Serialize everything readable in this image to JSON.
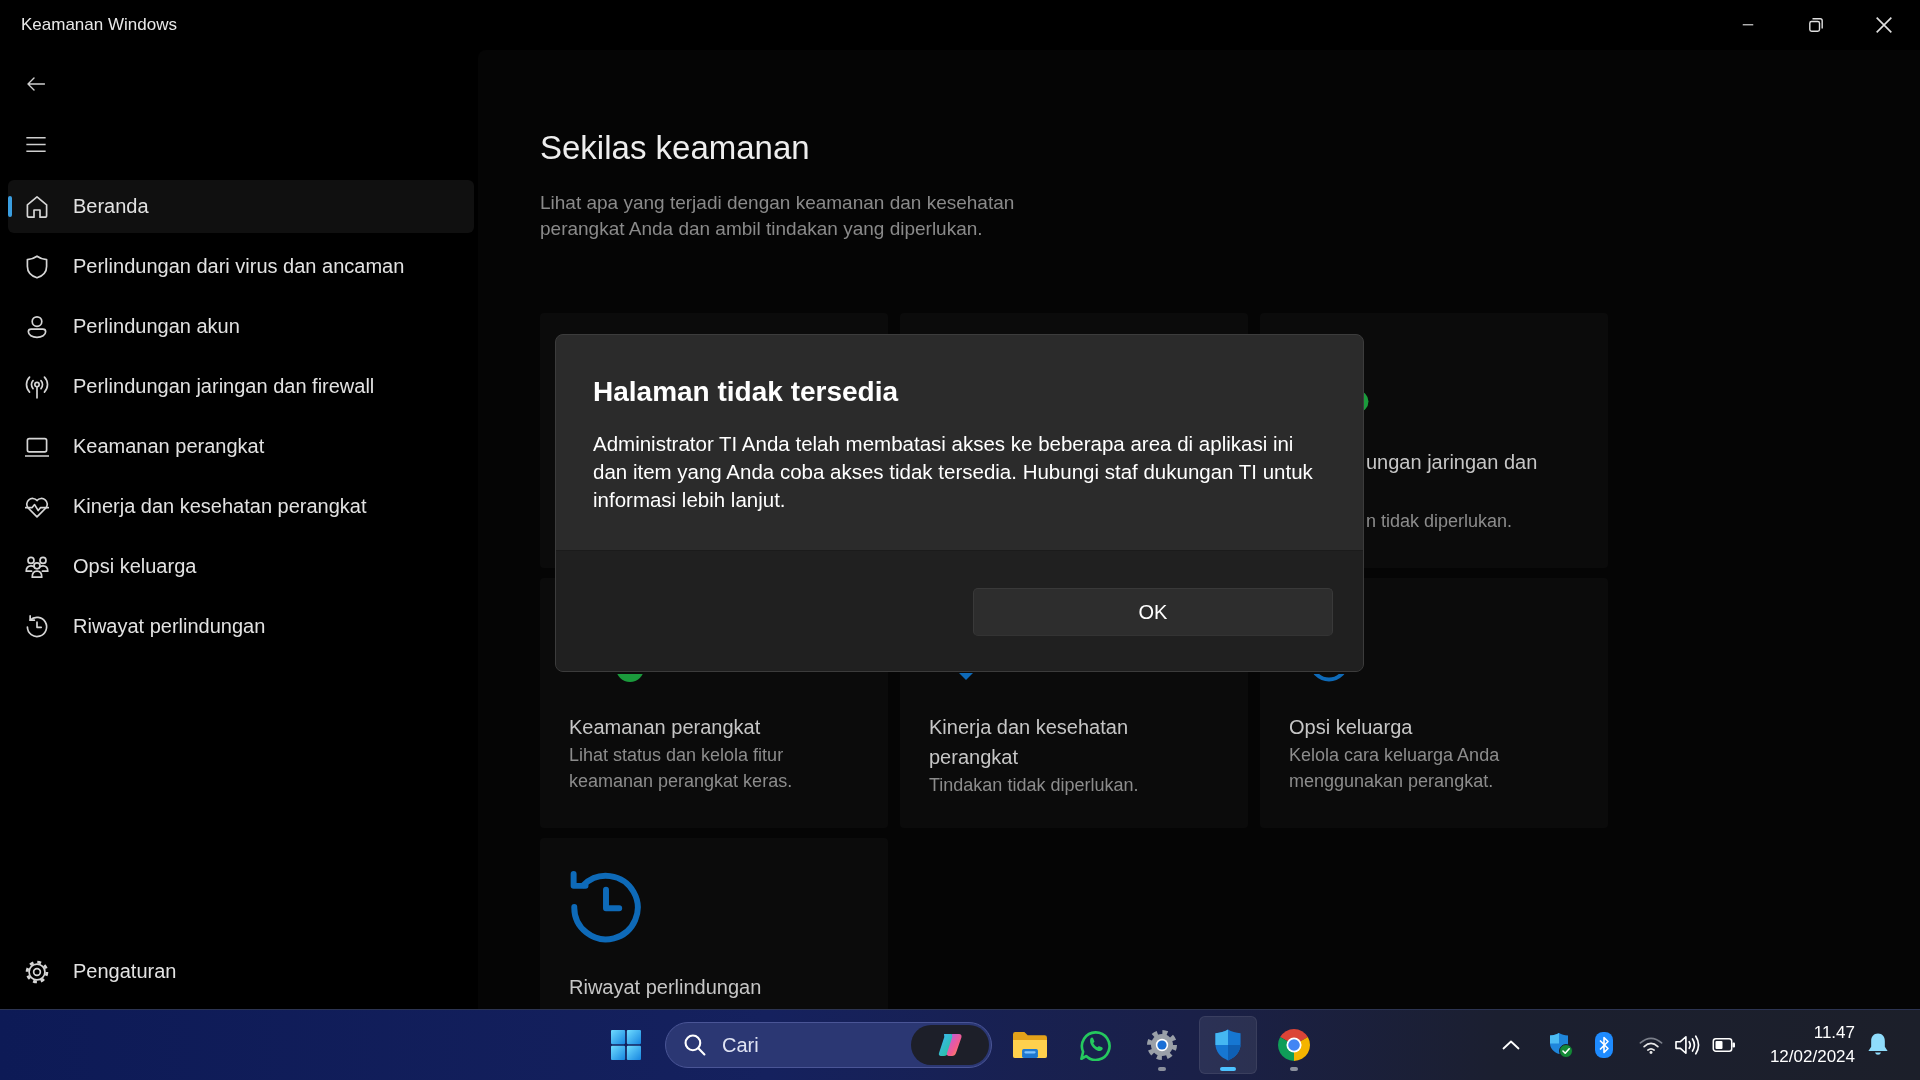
{
  "window": {
    "title": "Keamanan Windows"
  },
  "sidebar": {
    "items": [
      {
        "label": "Beranda",
        "kind": "home",
        "selected": true
      },
      {
        "label": "Perlindungan dari virus dan ancaman",
        "kind": "shield",
        "selected": false
      },
      {
        "label": "Perlindungan akun",
        "kind": "person",
        "selected": false
      },
      {
        "label": "Perlindungan jaringan dan firewall",
        "kind": "antenna",
        "selected": false
      },
      {
        "label": "Keamanan perangkat",
        "kind": "laptop",
        "selected": false
      },
      {
        "label": "Kinerja dan kesehatan perangkat",
        "kind": "heart",
        "selected": false
      },
      {
        "label": "Opsi keluarga",
        "kind": "family",
        "selected": false
      },
      {
        "label": "Riwayat perlindungan",
        "kind": "history",
        "selected": false
      }
    ],
    "settings": {
      "label": "Pengaturan"
    }
  },
  "page": {
    "title": "Sekilas keamanan",
    "subtitle": "Lihat apa yang terjadi dengan keamanan dan kesehatan perangkat Anda dan ambil tindakan yang diperlukan."
  },
  "cards": [
    {
      "kind": "covered"
    },
    {
      "kind": "covered"
    },
    {
      "kind": "side",
      "color": "#1b9a3c",
      "title": "ungan jaringan dan",
      "description": "n tidak diperlukan."
    },
    {
      "kind": "bottom-arc",
      "color": "#1b9a3c",
      "title": "Keamanan perangkat",
      "description": "Lihat status dan kelola fitur keamanan perangkat keras."
    },
    {
      "kind": "bottom-tip",
      "color": "#0e6ab8",
      "title": "Kinerja dan kesehatan perangkat",
      "description": "Tindakan tidak diperlukan."
    },
    {
      "kind": "bottom-ring",
      "color": "#0e6ab8",
      "title": "Opsi keluarga",
      "description": "Kelola cara keluarga Anda menggunakan perangkat."
    },
    {
      "kind": "full",
      "color": "#0e6ab8",
      "title": "Riwayat perlindungan"
    }
  ],
  "dialog": {
    "title": "Halaman tidak tersedia",
    "message": "Administrator TI Anda telah membatasi akses ke beberapa area di aplikasi ini dan item yang Anda coba akses tidak tersedia. Hubungi staf dukungan TI untuk informasi lebih lanjut.",
    "button": "OK"
  },
  "taskbar": {
    "search": {
      "placeholder": "Cari"
    },
    "apps": [
      {
        "kind": "folder",
        "running": false,
        "active": false
      },
      {
        "kind": "chat",
        "running": false,
        "active": false
      },
      {
        "kind": "gear",
        "running": true,
        "active": false
      },
      {
        "kind": "shield",
        "running": true,
        "active": true
      },
      {
        "kind": "browser",
        "running": true,
        "active": false
      }
    ],
    "time": "11.47",
    "date": "12/02/2024"
  }
}
